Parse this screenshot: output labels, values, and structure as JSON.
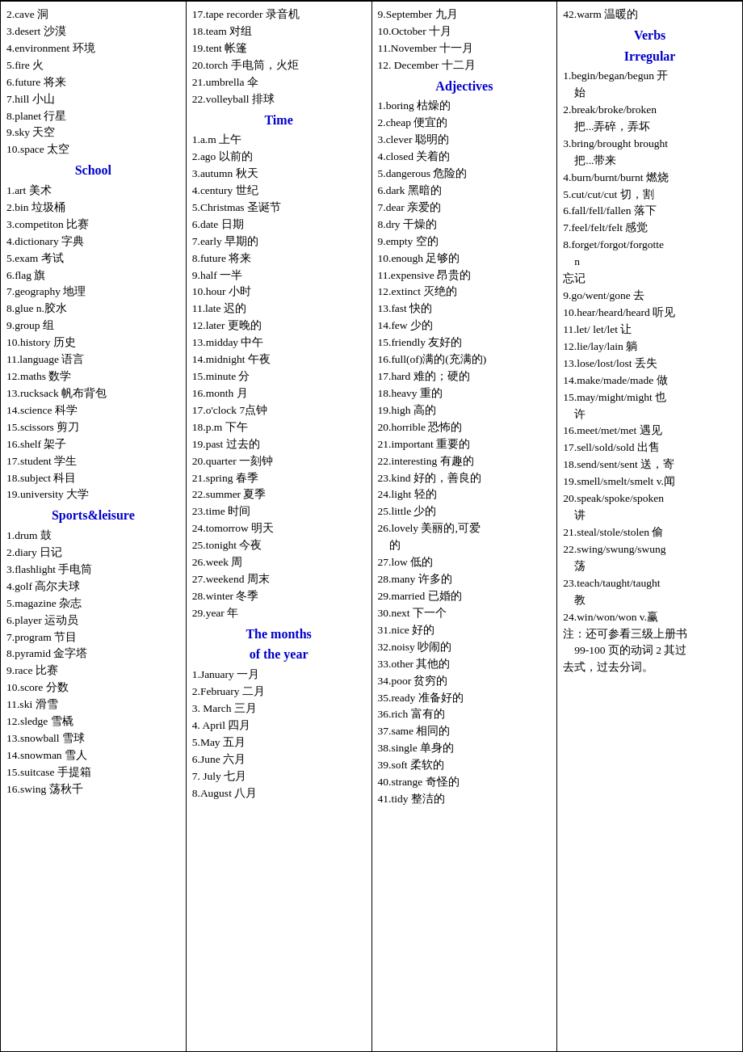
{
  "columns": [
    {
      "id": "col1",
      "entries": [
        {
          "text": "2.cave  洞"
        },
        {
          "text": "3.desert  沙漠"
        },
        {
          "text": "4.environment 环境"
        },
        {
          "text": "5.fire  火"
        },
        {
          "text": "6.future  将来"
        },
        {
          "text": "7.hill  小山"
        },
        {
          "text": "8.planet  行星"
        },
        {
          "text": "9.sky  天空"
        },
        {
          "text": "10.space  太空"
        },
        {
          "type": "heading",
          "text": "School"
        },
        {
          "text": "1.art  美术"
        },
        {
          "text": "2.bin  垃圾桶"
        },
        {
          "text": "3.competiton 比赛"
        },
        {
          "text": "4.dictionary 字典"
        },
        {
          "text": "5.exam  考试"
        },
        {
          "text": "6.flag 旗"
        },
        {
          "text": "7.geography 地理"
        },
        {
          "text": "8.glue n.胶水"
        },
        {
          "text": "9.group  组"
        },
        {
          "text": "10.history  历史"
        },
        {
          "text": "11.language  语言"
        },
        {
          "text": "12.maths  数学"
        },
        {
          "text": "13.rucksack 帆布背包"
        },
        {
          "text": "14.science  科学"
        },
        {
          "text": "15.scissors  剪刀"
        },
        {
          "text": "16.shelf  架子"
        },
        {
          "text": "17.student  学生"
        },
        {
          "text": "18.subject  科目"
        },
        {
          "text": "19.university  大学"
        },
        {
          "type": "heading",
          "text": "Sports&leisure"
        },
        {
          "text": "1.drum  鼓"
        },
        {
          "text": "2.diary  日记"
        },
        {
          "text": "3.flashlight  手电筒"
        },
        {
          "text": "4.golf 高尔夫球"
        },
        {
          "text": "5.magazine  杂志"
        },
        {
          "text": "6.player  运动员"
        },
        {
          "text": "7.program  节目"
        },
        {
          "text": "8.pyramid 金字塔"
        },
        {
          "text": "9.race 比赛"
        },
        {
          "text": "10.score  分数"
        },
        {
          "text": "11.ski 滑雪"
        },
        {
          "text": "12.sledge 雪橇"
        },
        {
          "text": "13.snowball 雪球"
        },
        {
          "text": "14.snowman 雪人"
        },
        {
          "text": "15.suitcase  手提箱"
        },
        {
          "text": "16.swing  荡秋千"
        }
      ]
    },
    {
      "id": "col2",
      "entries": [
        {
          "text": "17.tape recorder 录音机"
        },
        {
          "text": "18.team  对组"
        },
        {
          "text": "19.tent  帐篷"
        },
        {
          "text": "20.torch  手电筒，火炬"
        },
        {
          "text": "21.umbrella  伞"
        },
        {
          "text": "22.volleyball  排球"
        },
        {
          "type": "heading",
          "text": "Time"
        },
        {
          "text": "1.a.m 上午"
        },
        {
          "text": "2.ago  以前的"
        },
        {
          "text": "3.autumn 秋天"
        },
        {
          "text": "4.century 世纪"
        },
        {
          "text": "5.Christmas 圣诞节"
        },
        {
          "text": "6.date  日期"
        },
        {
          "text": "7.early  早期的"
        },
        {
          "text": "8.future  将来"
        },
        {
          "text": "9.half  一半"
        },
        {
          "text": "10.hour  小时"
        },
        {
          "text": "11.late  迟的"
        },
        {
          "text": "12.later  更晚的"
        },
        {
          "text": "13.midday  中午"
        },
        {
          "text": "14.midnight 午夜"
        },
        {
          "text": "15.minute  分"
        },
        {
          "text": "16.month  月"
        },
        {
          "text": "17.o'clock  7点钟"
        },
        {
          "text": "18.p.m  下午"
        },
        {
          "text": "19.past  过去的"
        },
        {
          "text": "20.quarter 一刻钟"
        },
        {
          "text": "21.spring 春季"
        },
        {
          "text": "22.summer 夏季"
        },
        {
          "text": "23.time  时间"
        },
        {
          "text": "24.tomorrow  明天"
        },
        {
          "text": "25.tonight 今夜"
        },
        {
          "text": "26.week  周"
        },
        {
          "text": "27.weekend  周末"
        },
        {
          "text": "28.winter  冬季"
        },
        {
          "text": "29.year  年"
        },
        {
          "type": "heading",
          "text": "The months",
          "line2": "of the year"
        },
        {
          "text": "1.January  一月"
        },
        {
          "text": "2.February  二月"
        },
        {
          "text": "3. March  三月"
        },
        {
          "text": "4. April  四月"
        },
        {
          "text": "5.May  五月"
        },
        {
          "text": "6.June  六月"
        },
        {
          "text": "7. July  七月"
        },
        {
          "text": "8.August  八月"
        }
      ]
    },
    {
      "id": "col3",
      "entries": [
        {
          "text": "9.September 九月"
        },
        {
          "text": "10.October  十月"
        },
        {
          "text": "11.November 十一月"
        },
        {
          "text": "12. December 十二月"
        },
        {
          "type": "heading",
          "text": "Adjectives"
        },
        {
          "text": "1.boring  枯燥的"
        },
        {
          "text": "2.cheap  便宜的"
        },
        {
          "text": "3.clever  聪明的"
        },
        {
          "text": "4.closed  关着的"
        },
        {
          "text": "5.dangerous 危险的"
        },
        {
          "text": "6.dark  黑暗的"
        },
        {
          "text": "7.dear  亲爱的"
        },
        {
          "text": "8.dry  干燥的"
        },
        {
          "text": "9.empty  空的"
        },
        {
          "text": "10.enough  足够的"
        },
        {
          "text": "11.expensive 昂贵的"
        },
        {
          "text": "12.extinct  灭绝的"
        },
        {
          "text": "13.fast  快的"
        },
        {
          "text": "14.few  少的"
        },
        {
          "text": "15.friendly  友好的"
        },
        {
          "text": "16.full(of)满的(充满的)"
        },
        {
          "text": "17.hard  难的；硬的"
        },
        {
          "text": "18.heavy  重的"
        },
        {
          "text": "19.high  高的"
        },
        {
          "text": "20.horrible 恐怖的"
        },
        {
          "text": "21.important  重要的"
        },
        {
          "text": "22.interesting  有趣的"
        },
        {
          "text": "23.kind  好的，善良的"
        },
        {
          "text": "24.light  轻的"
        },
        {
          "text": "25.little  少的"
        },
        {
          "text": "26.lovely 美丽的,可爱",
          "indent": "的"
        },
        {
          "text": "27.low  低的"
        },
        {
          "text": "28.many  许多的"
        },
        {
          "text": "29.married  已婚的"
        },
        {
          "text": "30.next  下一个"
        },
        {
          "text": "31.nice  好的"
        },
        {
          "text": "32.noisy  吵闹的"
        },
        {
          "text": "33.other  其他的"
        },
        {
          "text": "34.poor  贫穷的"
        },
        {
          "text": "35.ready  准备好的"
        },
        {
          "text": "36.rich  富有的"
        },
        {
          "text": "37.same  相同的"
        },
        {
          "text": "38.single  单身的"
        },
        {
          "text": "39.soft  柔软的"
        },
        {
          "text": "40.strange  奇怪的"
        },
        {
          "text": "41.tidy  整洁的"
        }
      ]
    },
    {
      "id": "col4",
      "entries": [
        {
          "text": "42.warm  温暖的"
        },
        {
          "type": "heading",
          "text": "Verbs",
          "line2": "Irregular"
        },
        {
          "text": "1.begin/began/begun  开",
          "indent": "始"
        },
        {
          "text": "2.break/broke/broken",
          "indent": "把...弄碎，弄坏"
        },
        {
          "text": "3.bring/brought  brought",
          "indent": "把...带来"
        },
        {
          "text": "4.burn/burnt/burnt 燃烧"
        },
        {
          "text": "5.cut/cut/cut  切，割"
        },
        {
          "text": "6.fall/fell/fallen  落下"
        },
        {
          "text": "7.feel/felt/felt  感觉"
        },
        {
          "text": "8.forget/forgot/forgotte",
          "indent": "n"
        },
        {
          "text": "  忘记"
        },
        {
          "text": "9.go/went/gone 去"
        },
        {
          "text": "10.hear/heard/heard 听见"
        },
        {
          "text": "11.let/ let/let  让"
        },
        {
          "text": "12.lie/lay/lain  躺"
        },
        {
          "text": "13.lose/lost/lost  丢失"
        },
        {
          "text": "14.make/made/made  做"
        },
        {
          "text": "15.may/might/might  也",
          "indent": "许"
        },
        {
          "text": "16.meet/met/met  遇见"
        },
        {
          "text": "17.sell/sold/sold  出售"
        },
        {
          "text": "18.send/sent/sent 送，寄"
        },
        {
          "text": "19.smell/smelt/smelt v.闻"
        },
        {
          "text": "20.speak/spoke/spoken",
          "indent": "讲"
        },
        {
          "text": "21.steal/stole/stolen  偷"
        },
        {
          "text": "22.swing/swung/swung",
          "indent": "荡"
        },
        {
          "text": "23.teach/taught/taught",
          "indent": "教"
        },
        {
          "text": "24.win/won/won v.赢"
        },
        {
          "text": "注：还可参看三级上册书",
          "indent": "99-100 页的动词 2 其过"
        },
        {
          "text": "  去式，过去分词。"
        }
      ]
    }
  ]
}
